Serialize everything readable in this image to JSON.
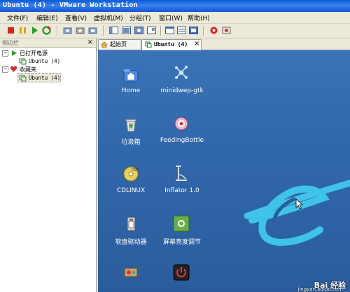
{
  "window": {
    "title": "Ubuntu (4) - VMware Workstation"
  },
  "menu": [
    "文件(F)",
    "编辑(E)",
    "查看(V)",
    "虚拟机(M)",
    "分组(T)",
    "窗口(W)",
    "帮助(H)"
  ],
  "sidebar": {
    "title": "侧边栏",
    "close": "×",
    "groups": [
      {
        "label": "已打开电源",
        "expand": "−",
        "items": [
          "Ubuntu (4)"
        ]
      },
      {
        "label": "收藏夹",
        "expand": "−",
        "items": [
          "Ubuntu (4)"
        ]
      }
    ]
  },
  "tabs": [
    {
      "label": "起始页",
      "icon": "home-icon"
    },
    {
      "label": "Ubuntu (4)",
      "icon": "vm-icon",
      "close": "×"
    }
  ],
  "desktop": {
    "icons": [
      {
        "label": "Home",
        "icon": "home-folder-icon"
      },
      {
        "label": "minidwep-gtk",
        "icon": "wifi-tool-icon"
      },
      {
        "label": "垃圾箱",
        "icon": "trash-icon"
      },
      {
        "label": "FeedingBottle",
        "icon": "feeding-bottle-icon"
      },
      {
        "label": "CDLINUX",
        "icon": "dvd-icon"
      },
      {
        "label": "Inflator 1.0",
        "icon": "inflator-icon"
      },
      {
        "label": "软盘驱动器",
        "icon": "floppy-drive-icon"
      },
      {
        "label": "屏幕亮度调节",
        "icon": "brightness-icon"
      }
    ]
  },
  "watermark": {
    "text": "Bai 经验",
    "url": "jingyan.baidu.com"
  },
  "colors": {
    "titlebar": "#0a5bd6",
    "desktop": "#3168ac",
    "logo": "#3fc3e8"
  }
}
